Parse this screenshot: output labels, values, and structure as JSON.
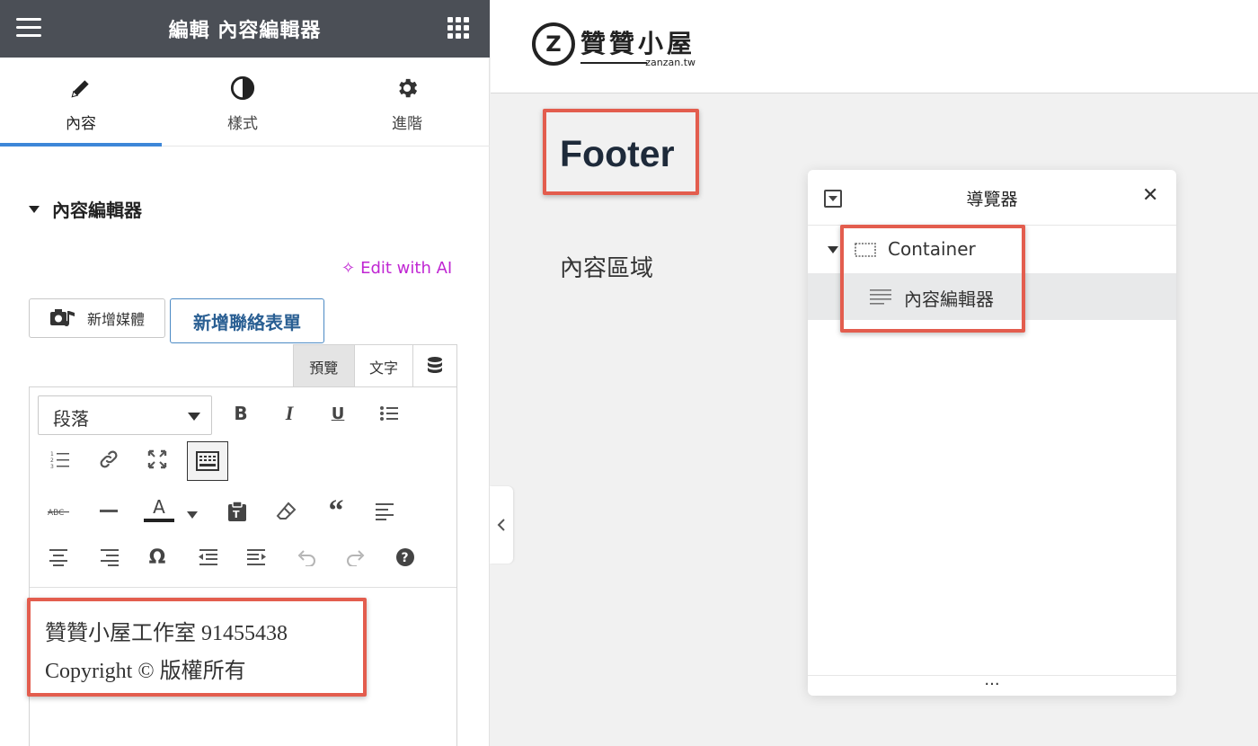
{
  "panel": {
    "title": "編輯 內容編輯器",
    "tabs": [
      {
        "label": "內容",
        "icon": "pencil-icon"
      },
      {
        "label": "樣式",
        "icon": "half-circle-icon"
      },
      {
        "label": "進階",
        "icon": "gear-icon"
      }
    ],
    "section_title": "內容編輯器",
    "ai_link": "Edit with AI",
    "add_media": "新增媒體",
    "add_form": "新增聯絡表單",
    "mode_tabs": [
      "預覽",
      "文字"
    ],
    "format_select": "段落",
    "content_lines": [
      "贊贊小屋工作室   91455438",
      "Copyright © 版權所有"
    ]
  },
  "toolbar_icons": {
    "bold": "B",
    "italic": "I",
    "underline": "U",
    "text_color": "A",
    "special_char": "Ω"
  },
  "logo": {
    "name": "贊贊小屋",
    "domain": "zanzan.tw",
    "mark": "Z"
  },
  "preview": {
    "title": "Footer",
    "content": "內容區域"
  },
  "navigator": {
    "title": "導覽器",
    "close": "✕",
    "items": [
      {
        "label": "Container"
      },
      {
        "label": "內容編輯器"
      }
    ],
    "footer": "..."
  },
  "colors": {
    "header_bg": "#4b4f56",
    "accent": "#3d86d8",
    "ai": "#c026d3",
    "highlight": "#e35d4e"
  }
}
